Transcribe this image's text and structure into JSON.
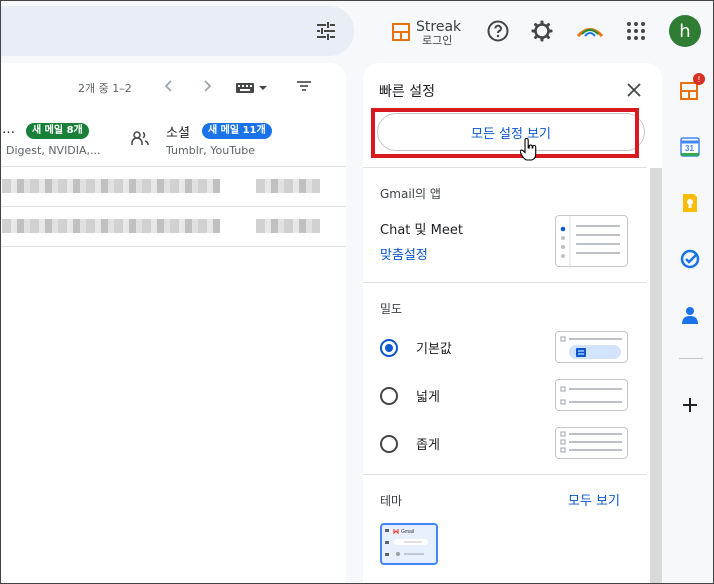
{
  "topbar": {
    "streak_name": "Streak",
    "streak_login": "로그인",
    "avatar_letter": "h"
  },
  "mail": {
    "pager": "2개 중 1–2",
    "categories": [
      {
        "title": "…",
        "badge": "새 메일 8개",
        "badge_color": "#188038",
        "subtitle": "Digest, NVIDIA,..."
      },
      {
        "title": "소셜",
        "badge": "새 메일 11개",
        "badge_color": "#1a73e8",
        "subtitle": "Tumblr, YouTube"
      }
    ]
  },
  "quick_settings": {
    "title": "빠른 설정",
    "see_all_button": "모든 설정 보기",
    "apps_section": "Gmail의 앱",
    "app_name": "Chat 및 Meet",
    "app_customize": "맞춤설정",
    "density_section": "밀도",
    "density_options": [
      {
        "label": "기본값",
        "selected": true
      },
      {
        "label": "넓게",
        "selected": false
      },
      {
        "label": "좁게",
        "selected": false
      }
    ],
    "theme_section": "테마",
    "theme_see_all": "모두 보기",
    "theme_thumb_label": "Gmail"
  },
  "colors": {
    "accent": "#0b57d0",
    "highlight": "#d71920"
  },
  "rail": {
    "streak_badge": "!"
  }
}
